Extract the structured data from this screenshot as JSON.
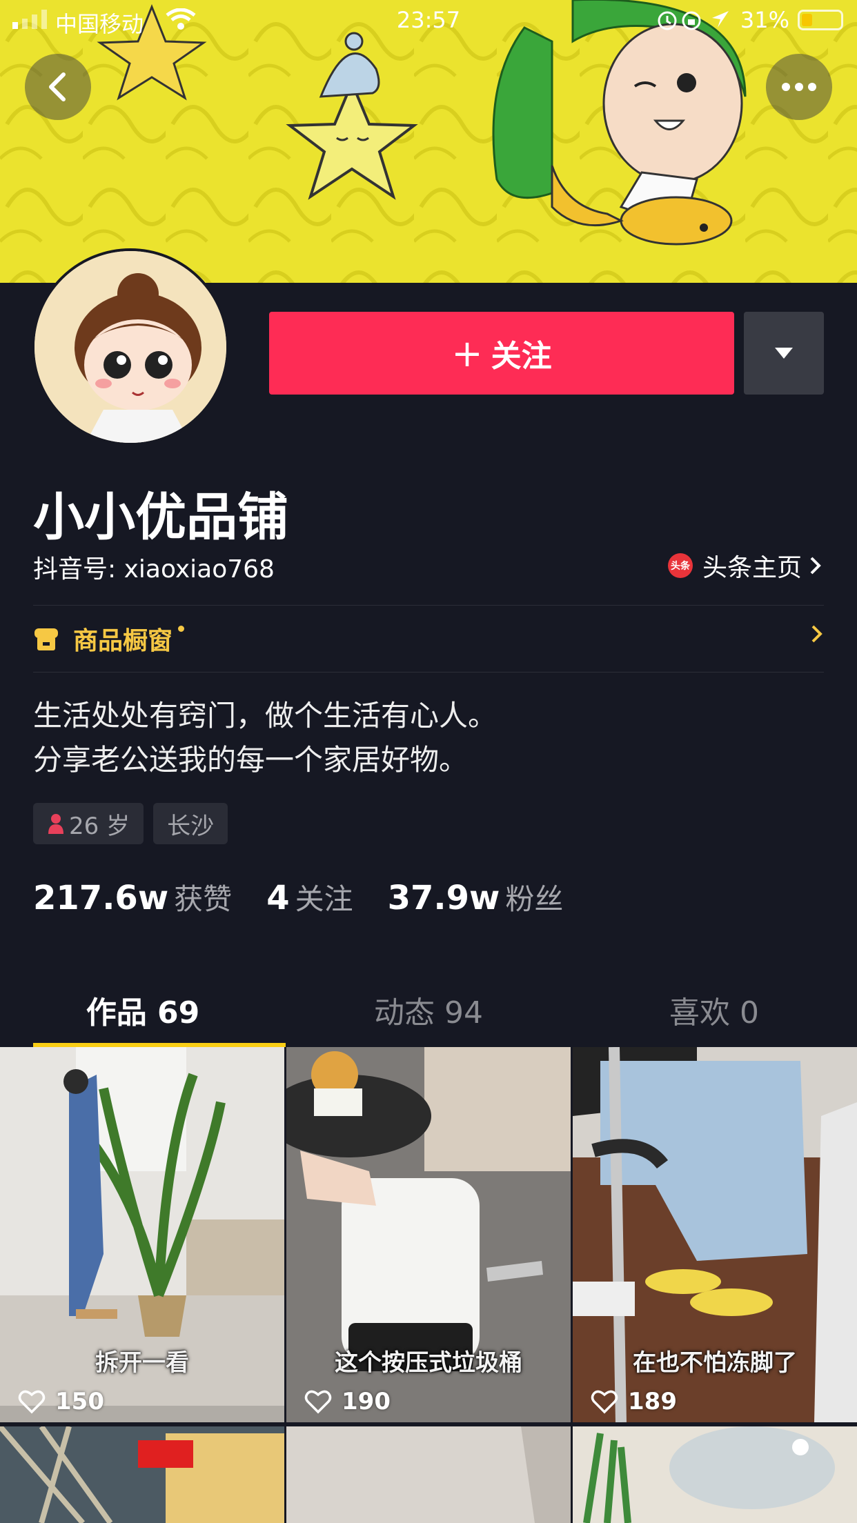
{
  "status_bar": {
    "carrier": "中国移动",
    "time": "23:57",
    "battery": "31%"
  },
  "profile": {
    "follow_label": "关注",
    "name": "小小优品铺",
    "douyin_id": "抖音号: xiaoxiao768",
    "toutiao_label": "头条主页",
    "toutiao_icon_text": "头条",
    "shop_label": "商品橱窗",
    "bio_line1": "生活处处有窍门，做个生活有心人。",
    "bio_line2": "分享老公送我的每一个家居好物。",
    "tags": {
      "age": "26 岁",
      "city": "长沙"
    },
    "stats": {
      "likes_num": "217.6w",
      "likes_label": "获赞",
      "following_num": "4",
      "following_label": "关注",
      "fans_num": "37.9w",
      "fans_label": "粉丝"
    }
  },
  "tabs": {
    "works": "作品 69",
    "activity": "动态 94",
    "liked": "喜欢 0"
  },
  "videos": [
    {
      "caption": "拆开一看",
      "likes": "150"
    },
    {
      "caption": "这个按压式垃圾桶",
      "likes": "190"
    },
    {
      "caption": "在也不怕冻脚了",
      "likes": "189"
    }
  ],
  "colors": {
    "background": "#161823",
    "follow": "#fe2c55",
    "accent_yellow": "#face15",
    "shop": "#f6c844"
  },
  "icons": [
    "back-arrow-icon",
    "more-dots-icon",
    "dropdown-triangle-icon",
    "toutiao-icon",
    "shop-icon",
    "chevron-right-icon",
    "female-icon",
    "heart-icon",
    "wifi-icon",
    "alarm-icon",
    "location-icon",
    "battery-icon"
  ]
}
